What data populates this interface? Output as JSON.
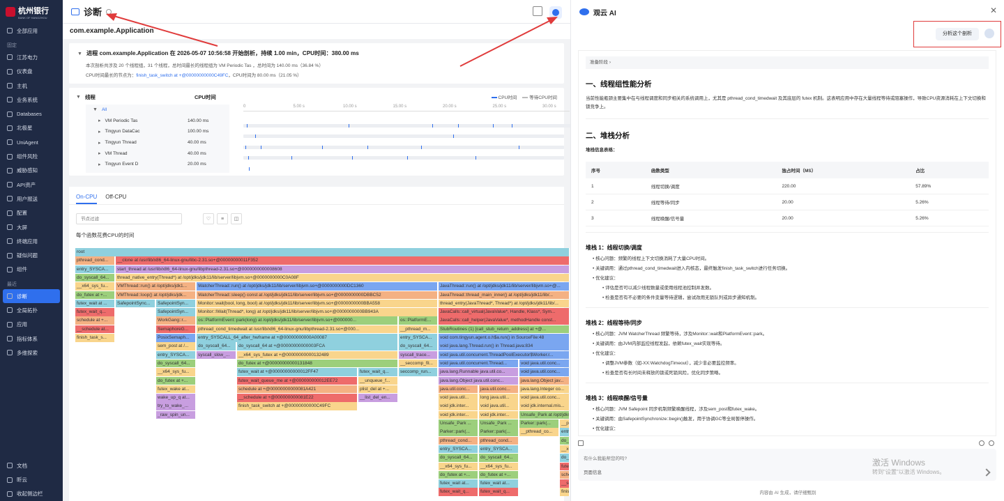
{
  "sidebar": {
    "logo_text": "杭州银行",
    "logo_sub": "BANK OF HANGZHOU",
    "all_apps": "全部应用",
    "group_pinned": "固定",
    "pinned": [
      "江苏电力",
      "仪表盘",
      "主机",
      "业务系统",
      "Databases",
      "北极星",
      "UniAgent",
      "组件风险",
      "威胁感知",
      "API资产",
      "用户报送",
      "配置",
      "大屏",
      "终端应用",
      "疑似问题",
      "组件"
    ],
    "group_recent": "最近",
    "recent": [
      "诊断",
      "全局拓扑",
      "应用",
      "指标体系",
      "多维探索"
    ],
    "bottom": [
      "文档",
      "昕云",
      "收起侧边栏"
    ]
  },
  "header": {
    "title": "诊断",
    "app": "com.example.Application"
  },
  "process": {
    "title": "进程 com.example.Application 在 2026-05-07 10:56:58 开始剖析，持续 1.00 min，CPU时间：380.00 ms",
    "line1": "本次剖析共涉及 20 个线程组，31 个线程，总时间最长的线程组为 VM Periodic Tas ，总时间为 140.00 ms（36.84 %）",
    "line2_prefix": "CPU时间最长的节点为：",
    "line2_link": "finish_task_switch at +@00000000000C49FC",
    "line2_suffix": "，CPU时间为 80.00 ms（21.05 %）"
  },
  "threads": {
    "title": "线程",
    "col": "CPU时间",
    "legend_cpu": "CPU时间",
    "legend_wait": "等待CPU时间",
    "all": "All",
    "rows": [
      {
        "name": "VM Periodic Tas",
        "value": "140.00 ms"
      },
      {
        "name": "Tingyun DataCac",
        "value": "100.00 ms"
      },
      {
        "name": "Tingyun Thread",
        "value": "40.00 ms"
      },
      {
        "name": "VM Thread",
        "value": "40.00 ms"
      },
      {
        "name": "Tingyun Event D",
        "value": "20.00 ms"
      }
    ],
    "ticks": [
      "0",
      "5.00 s",
      "10.00 s",
      "15.00 s",
      "20.00 s",
      "25.00 s",
      "30.00 s"
    ]
  },
  "flame": {
    "tab_on": "On-CPU",
    "tab_off": "Off-CPU",
    "search_placeholder": "节点过滤",
    "label": "每个函数花费CPU的时间"
  },
  "ai": {
    "title": "观云 AI",
    "user_msg": "分析这个剖析",
    "phase": "准备阶段",
    "s1": "一、线程组性能分析",
    "p1": "当前性能瓶颈主要集中在与线程调度和同步相关的系统调用上，尤其是 pthread_cond_timedwait 及其底层的 futex 机制。这表明应用中存在大量线程等待或阻塞操作，导致CPU资源消耗在上下文切换和锁竞争上。",
    "s2": "二、堆栈分析",
    "table_label": "堆栈信息表格：",
    "table_head": [
      "序号",
      "函数类型",
      "独占时间（MS）",
      "占比"
    ],
    "table_rows": [
      [
        "1",
        "线程切换/调度",
        "220.00",
        "57.89%"
      ],
      [
        "2",
        "线程等待/同步",
        "20.00",
        "5.26%"
      ],
      [
        "3",
        "线程唤醒/信号量",
        "20.00",
        "5.26%"
      ]
    ],
    "st1": "堆栈 1：线程切换/调度",
    "st1_items": [
      "核心问题：频繁的线程上下文切换消耗了大量CPU时间。",
      "关键调用：通过pthread_cond_timedwait进入内核态，最终触发finish_task_switch进行任务切换。",
      "优化建议："
    ],
    "st1_sub": [
      "评估是否可以减少线程数量或使用线程池控制并发数。",
      "检查是否有不必要的条件变量等待逻辑，尝试改用无锁队列或异步通知机制。"
    ],
    "st2": "堆栈 2：线程等待/同步",
    "st2_items": [
      "核心问题：JVM WatcherThread 频繁等待，涉及Monitor::wait和PlatformEvent::park。",
      "关键调用：由JVM内部监控线程发起，依赖futex_wait实现等待。",
      "优化建议："
    ],
    "st2_sub": [
      "调整JVM参数（如-XX:WatchdogTimeout），减少非必要监控频率。",
      "检查是否有长时间未释放的锁或死锁风险，优化同步策略。"
    ],
    "st3": "堆栈 3：线程唤醒/信号量",
    "st3_items": [
      "核心问题：JVM Safepoint 同步机制频繁唤醒线程，涉及sem_post和futex_wake。",
      "关键调用：由SafepointSynchronize::begin()触发，用于协调GC等全局暂停操作。",
      "优化建议："
    ],
    "st3_sub": [
      "优化GC策略，减少Full GC频率。",
      "考虑升级JDK版本，利用更高效的Safepoint实现。"
    ],
    "input_placeholder": "有什么我能帮您的吗?",
    "input_tag": "页面信息",
    "footer": "内容由 AI 生成，请仔细甄别",
    "watermark1": "激活 Windows",
    "watermark2": "转到\"设置\"以激活 Windows。"
  },
  "frames": [
    [
      "root",
      0,
      0,
      709,
      "#8fd0de"
    ],
    [
      "pthread_cond...",
      1,
      0,
      57,
      "#f4b183"
    ],
    [
      "__clone at /usr/lib/x86_64-linux-gnu/libc-2.31.so+@00000000011F352",
      1,
      58,
      651,
      "#ee6b6b"
    ],
    [
      "entry_SYSCA...",
      2,
      0,
      57,
      "#8fd0de"
    ],
    [
      "start_thread at /usr/lib/x86_64-linux-gnu/libpthread-2.31.so+@0000000000008608",
      2,
      58,
      651,
      "#c89ee0"
    ],
    [
      "do_syscall_64...",
      3,
      0,
      57,
      "#9ccf7c"
    ],
    [
      "thread_native_entry(Thread*) at /opt/jdks/jdk11/lib/server/libjvm.so+@0000000000C0A08F",
      3,
      58,
      651,
      "#f9d58c"
    ],
    [
      "__x64_sys_fu...",
      4,
      0,
      57,
      "#f9d58c"
    ],
    [
      "VMThread::run() at /opt/jdks/jdk1...",
      4,
      58,
      115,
      "#f4b183"
    ],
    [
      "WatcherThread::run() at /opt/jdks/jdk11/lib/server/libjvm.so+@0000000000DC1360",
      4,
      174,
      346,
      "#7aa6f0"
    ],
    [
      "JavaThread::run() at /opt/jdks/jdk11/lib/server/libjvm.so+@...",
      4,
      521,
      188,
      "#7aa6f0"
    ],
    [
      "do_futex at +...",
      5,
      0,
      57,
      "#9ccf7c"
    ],
    [
      "VMThread::loop() at /opt/jdks/jdk...",
      5,
      58,
      115,
      "#f4b183"
    ],
    [
      "WatcherThread::sleep() const at /opt/jdks/jdk11/lib/server/libjvm.so+@0000000000DBBC52",
      5,
      174,
      346,
      "#f4b183"
    ],
    [
      "JavaThread::thread_main_inner() at /opt/jdks/jdk11/lib/...",
      5,
      521,
      188,
      "#f4b183"
    ],
    [
      "futex_wait at ...",
      6,
      0,
      57,
      "#8fd0de"
    ],
    [
      "SafepointSync...",
      6,
      58,
      57,
      "#8fd0de"
    ],
    [
      "SafepointSyn...",
      6,
      116,
      57,
      "#8fd0de"
    ],
    [
      "Monitor::wait(bool, long, bool) at /opt/jdks/jdk11/lib/server/libjvm.so+@0000000000BBA558",
      6,
      174,
      346,
      "#f9d58c"
    ],
    [
      "thread_entry(JavaThread*, Thread*) at /opt/jdks/jdk11/lib/...",
      6,
      521,
      188,
      "#f9d58c"
    ],
    [
      "futex_wait_q...",
      7,
      0,
      57,
      "#ee6b6b"
    ],
    [
      "SafepointSyn...",
      7,
      116,
      57,
      "#8fd0de"
    ],
    [
      "Monitor::IWait(Thread*, long) at /opt/jdks/jdk11/lib/server/libjvm.so+@0000000000BB943A",
      7,
      174,
      346,
      "#f9d58c"
    ],
    [
      "JavaCalls::call_virtual(JavaValue*, Handle, Klass*, Sym...",
      7,
      521,
      188,
      "#ee6b6b"
    ],
    [
      "schedule at +...",
      8,
      0,
      57,
      "#f4b183"
    ],
    [
      "WorkGang::r...",
      8,
      116,
      57,
      "#f4b183"
    ],
    [
      "os::PlatformEvent::park(long) at /opt/jdks/jdk11/lib/server/libjvm.so+@000000...",
      8,
      174,
      289,
      "#9ccf7c"
    ],
    [
      "os::PlatformE...",
      8,
      464,
      56,
      "#9ccf7c"
    ],
    [
      "JavaCalls::call_helper(JavaValue*, methodHandle const...",
      8,
      521,
      188,
      "#ee6b6b"
    ],
    [
      "__schedule at...",
      9,
      0,
      57,
      "#ee6b6b"
    ],
    [
      "SemaphoreG...",
      9,
      116,
      57,
      "#ee6b6b"
    ],
    [
      "pthread_cond_timedwait at /usr/lib/x86_64-linux-gnu/libpthread-2.31.so+@000...",
      9,
      174,
      289,
      "#f9d58c"
    ],
    [
      "__pthread_m...",
      9,
      464,
      56,
      "#f9d58c"
    ],
    [
      "StubRoutines (1) [call_stub_return_address] at +@...",
      9,
      521,
      188,
      "#9ccf7c"
    ],
    [
      "finish_task_s...",
      10,
      0,
      57,
      "#f9d58c"
    ],
    [
      "PosixSemaph...",
      10,
      116,
      57,
      "#7aa6f0"
    ],
    [
      "entry_SYSCALL_64_after_hwframe at +@00000000000A00087",
      10,
      174,
      289,
      "#8fd0de"
    ],
    [
      "entry_SYSCA...",
      10,
      464,
      56,
      "#8fd0de"
    ],
    [
      "void com.tingyun.agent.o.h$a.run() in SourceFile:48",
      10,
      521,
      188,
      "#7aa6f0"
    ],
    [
      "sem_post at /...",
      11,
      116,
      57,
      "#f9d58c"
    ],
    [
      "do_syscall_64...",
      11,
      174,
      57,
      "#8fd0de"
    ],
    [
      "do_syscall_64 at +@00000000000003FCA",
      11,
      232,
      231,
      "#8fd0de"
    ],
    [
      "do_syscall_64...",
      11,
      464,
      56,
      "#8fd0de"
    ],
    [
      "void java.lang.Thread.run() in Thread.java:834",
      11,
      521,
      188,
      "#7aa6f0"
    ],
    [
      "entry_SYSCA...",
      12,
      116,
      57,
      "#8fd0de"
    ],
    [
      "syscall_slow_...",
      12,
      174,
      57,
      "#c89ee0"
    ],
    [
      "__x64_sys_futex at +@00000000000132489",
      12,
      232,
      231,
      "#f9d58c"
    ],
    [
      "syscall_trace...",
      12,
      464,
      56,
      "#c89ee0"
    ],
    [
      "void java.util.concurrent.ThreadPoolExecutor$Worker.r...",
      12,
      521,
      188,
      "#7aa6f0"
    ],
    [
      "do_syscall_64...",
      13,
      116,
      57,
      "#9ccf7c"
    ],
    [
      "do_futex at +@00000000000131848",
      13,
      232,
      231,
      "#9ccf7c"
    ],
    [
      "__seccomp_fil...",
      13,
      464,
      56,
      "#f9d58c"
    ],
    [
      "void java.util.concurrent.Thread...",
      13,
      521,
      115,
      "#7aa6f0"
    ],
    [
      "void java.util.conc...",
      13,
      637,
      72,
      "#7aa6f0"
    ],
    [
      "__x64_sys_fu...",
      14,
      116,
      57,
      "#f9d58c"
    ],
    [
      "futex_wait at +@00000000000012FF47",
      14,
      232,
      173,
      "#8fd0de"
    ],
    [
      "futex_wait_q...",
      14,
      406,
      57,
      "#8fd0de"
    ],
    [
      "seccomp_run...",
      14,
      464,
      56,
      "#8fd0de"
    ],
    [
      "java.lang.Runnable java.util.co...",
      14,
      521,
      115,
      "#c89ee0"
    ],
    [
      "void java.util.conc...",
      14,
      637,
      72,
      "#7aa6f0"
    ],
    [
      "do_futex at +...",
      15,
      116,
      57,
      "#9ccf7c"
    ],
    [
      "futex_wait_queue_me at +@000000000012EE72",
      15,
      232,
      173,
      "#ee6b6b"
    ],
    [
      "__unqueue_f...",
      15,
      406,
      57,
      "#f9d58c"
    ],
    [
      "java.lang.Object java.util.conc...",
      15,
      521,
      115,
      "#c89ee0"
    ],
    [
      "java.lang.Object jav...",
      15,
      637,
      72,
      "#f4b183"
    ],
    [
      "futex_wake at...",
      16,
      116,
      57,
      "#f9d58c"
    ],
    [
      "schedule at +@00000000000081A421",
      16,
      232,
      173,
      "#f4b183"
    ],
    [
      "plist_del at +...",
      16,
      406,
      57,
      "#f9d58c"
    ],
    [
      "java.util.conc...",
      16,
      521,
      57,
      "#f4b183"
    ],
    [
      "java.util.conc...",
      16,
      579,
      57,
      "#f4b183"
    ],
    [
      "java.lang.Integer co...",
      16,
      637,
      72,
      "#f9d58c"
    ],
    [
      "wake_up_q at...",
      17,
      116,
      57,
      "#c89ee0"
    ],
    [
      "__schedule at +@000000000081E22",
      17,
      232,
      173,
      "#ee6b6b"
    ],
    [
      "__list_del_en...",
      17,
      406,
      57,
      "#c89ee0"
    ],
    [
      "void java.util...",
      17,
      521,
      57,
      "#f9d58c"
    ],
    [
      "long java.util...",
      17,
      579,
      57,
      "#f9d58c"
    ],
    [
      "void java.util.conc...",
      17,
      637,
      72,
      "#f9d58c"
    ],
    [
      "try_to_wake_...",
      18,
      116,
      57,
      "#c89ee0"
    ],
    [
      "finish_task_switch at +@00000000000C49FC",
      18,
      232,
      173,
      "#f9d58c"
    ],
    [
      "void jdk.inter...",
      18,
      521,
      57,
      "#f9d58c"
    ],
    [
      "void java.util...",
      18,
      579,
      57,
      "#f9d58c"
    ],
    [
      "void jdk.internal.mis...",
      18,
      637,
      72,
      "#f9d58c"
    ],
    [
      "_raw_spin_un...",
      19,
      116,
      57,
      "#c89ee0"
    ],
    [
      "void jdk.inter...",
      19,
      521,
      57,
      "#f9d58c"
    ],
    [
      "void jdk.inter...",
      19,
      579,
      57,
      "#f9d58c"
    ],
    [
      "Unsafe_Park at /opt/jdks/jdk11/...",
      19,
      637,
      72,
      "#9ccf7c"
    ],
    [
      "Unsafe_Park ...",
      20,
      521,
      57,
      "#9ccf7c"
    ],
    [
      "Unsafe_Park ...",
      20,
      579,
      57,
      "#9ccf7c"
    ],
    [
      "Parker::park(...",
      20,
      637,
      57,
      "#9ccf7c"
    ],
    [
      "__pthread_co...",
      20,
      695,
      14,
      "#f9d58c"
    ],
    [
      "Parker::park(...",
      21,
      521,
      57,
      "#9ccf7c"
    ],
    [
      "Parker::park(...",
      21,
      579,
      57,
      "#9ccf7c"
    ],
    [
      "__pthread_co...",
      21,
      637,
      57,
      "#f9d58c"
    ],
    [
      "entr...",
      21,
      695,
      14,
      "#8fd0de"
    ],
    [
      "pthread_cond...",
      22,
      521,
      57,
      "#f4b183"
    ],
    [
      "pthread_cond...",
      22,
      579,
      57,
      "#f4b183"
    ],
    [
      "do_s...",
      22,
      695,
      14,
      "#9ccf7c"
    ],
    [
      "entry_SYSCA...",
      23,
      521,
      57,
      "#8fd0de"
    ],
    [
      "entry_SYSCA...",
      23,
      579,
      57,
      "#8fd0de"
    ],
    [
      "__x6...",
      23,
      695,
      14,
      "#f9d58c"
    ],
    [
      "do_syscall_64...",
      24,
      521,
      57,
      "#9ccf7c"
    ],
    [
      "do_syscall_64...",
      24,
      579,
      57,
      "#9ccf7c"
    ],
    [
      "do_f...",
      24,
      695,
      14,
      "#8fd0de"
    ],
    [
      "__x64_sys_fu...",
      25,
      521,
      57,
      "#f9d58c"
    ],
    [
      "__x64_sys_fu...",
      25,
      579,
      57,
      "#f9d58c"
    ],
    [
      "futex...",
      25,
      695,
      14,
      "#ee6b6b"
    ],
    [
      "do_futex at +...",
      26,
      521,
      57,
      "#9ccf7c"
    ],
    [
      "do_futex at +...",
      26,
      579,
      57,
      "#9ccf7c"
    ],
    [
      "sche...",
      26,
      695,
      14,
      "#f4b183"
    ],
    [
      "futex_wait at...",
      27,
      521,
      57,
      "#8fd0de"
    ],
    [
      "futex_wait at...",
      27,
      579,
      57,
      "#8fd0de"
    ],
    [
      "__sc...",
      27,
      695,
      14,
      "#ee6b6b"
    ],
    [
      "futex_wait_q...",
      28,
      521,
      57,
      "#ee6b6b"
    ],
    [
      "futex_wait_q...",
      28,
      579,
      57,
      "#ee6b6b"
    ],
    [
      "finis...",
      28,
      695,
      14,
      "#f9d58c"
    ]
  ]
}
